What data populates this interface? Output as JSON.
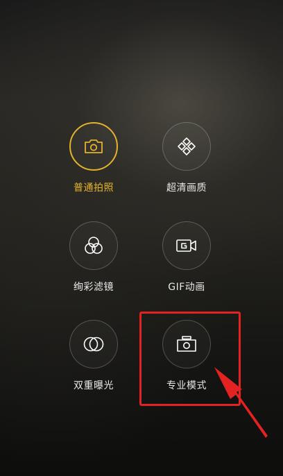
{
  "modes": [
    {
      "label": "普通拍照",
      "icon": "camera-icon",
      "active": true
    },
    {
      "label": "超清画质",
      "icon": "diamond-grid-icon",
      "active": false
    },
    {
      "label": "绚彩滤镜",
      "icon": "color-filter-icon",
      "active": false
    },
    {
      "label": "GIF动画",
      "icon": "gif-camera-icon",
      "active": false
    },
    {
      "label": "双重曝光",
      "icon": "double-exposure-icon",
      "active": false
    },
    {
      "label": "专业模式",
      "icon": "pro-camera-icon",
      "active": false
    }
  ],
  "colors": {
    "accent": "#e5b32b",
    "annotation": "#e32222",
    "label": "#e8e8e8",
    "icon_stroke": "#ffffff"
  }
}
